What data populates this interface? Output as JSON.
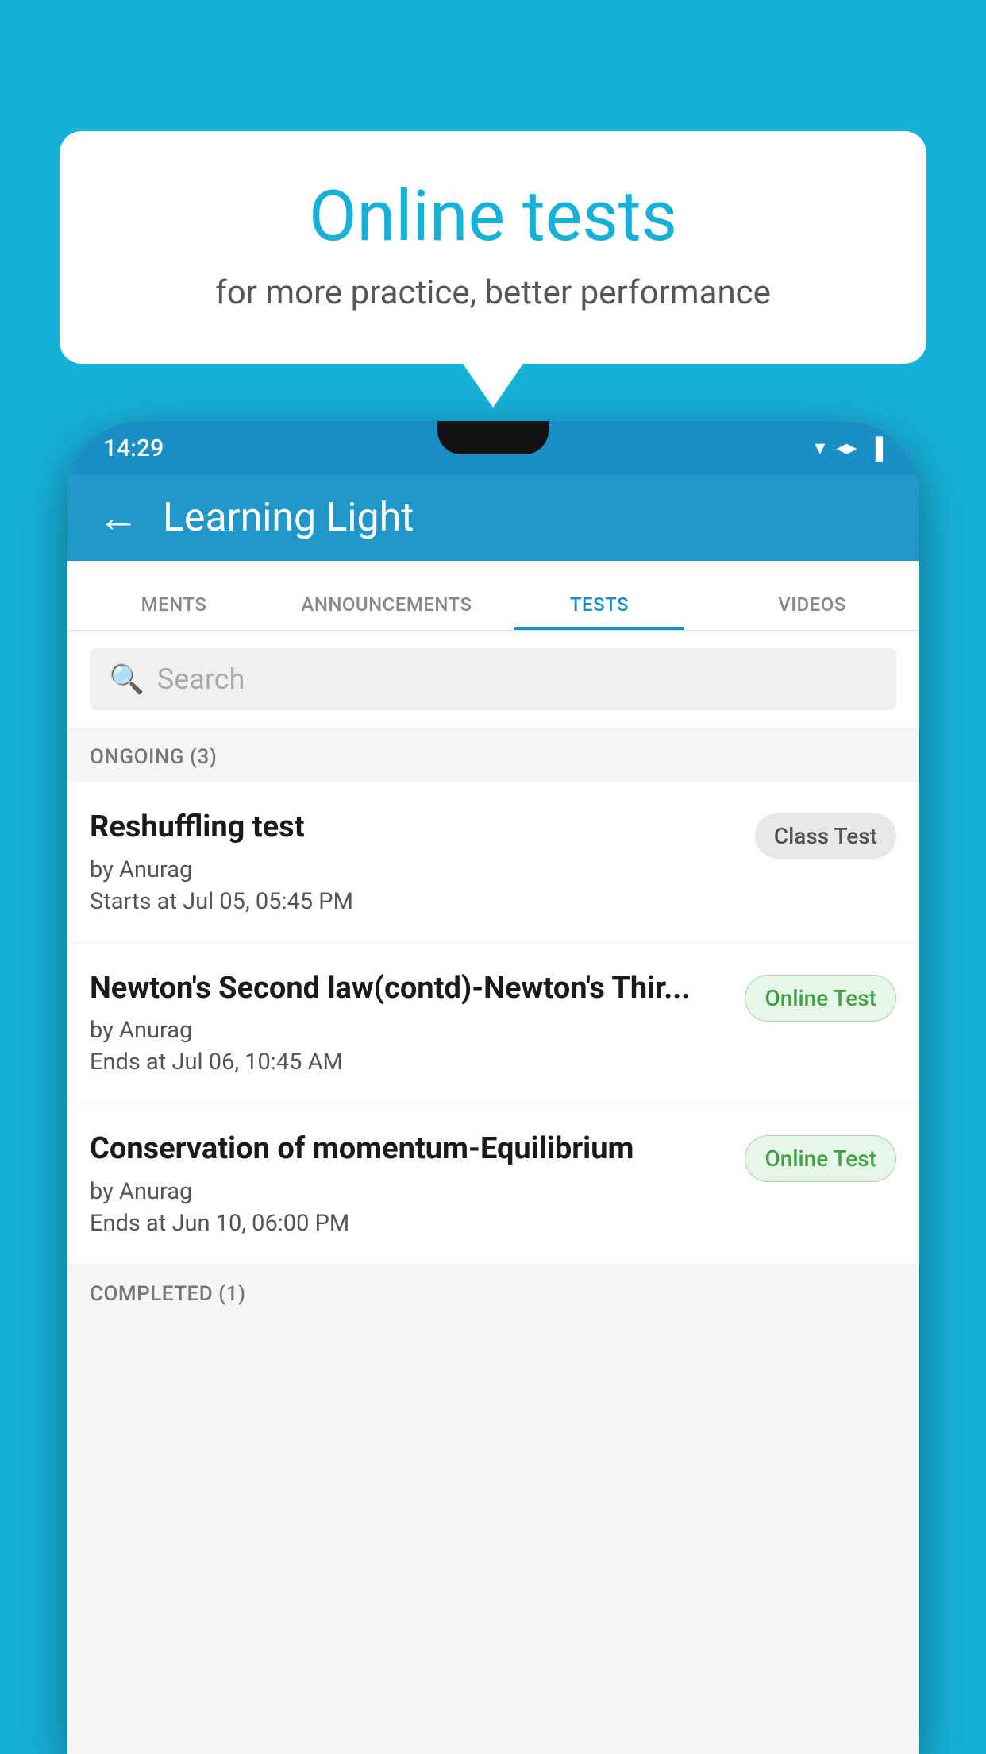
{
  "background_color": "#17b0d8",
  "bubble": {
    "title": "Online tests",
    "subtitle": "for more practice, better performance"
  },
  "phone": {
    "status_bar": {
      "time": "14:29",
      "icons": [
        "▼",
        "▲",
        "▌"
      ]
    },
    "app_bar": {
      "back_label": "←",
      "title": "Learning Light"
    },
    "tabs": [
      {
        "label": "MENTS",
        "active": false
      },
      {
        "label": "ANNOUNCEMENTS",
        "active": false
      },
      {
        "label": "TESTS",
        "active": true
      },
      {
        "label": "VIDEOS",
        "active": false
      }
    ],
    "search": {
      "placeholder": "Search"
    },
    "ongoing_section": {
      "label": "ONGOING (3)"
    },
    "tests": [
      {
        "name": "Reshuffling test",
        "by": "by Anurag",
        "date_label": "Starts at",
        "date": "Jul 05, 05:45 PM",
        "badge": "Class Test",
        "badge_type": "class"
      },
      {
        "name": "Newton's Second law(contd)-Newton's Thir...",
        "by": "by Anurag",
        "date_label": "Ends at",
        "date": "Jul 06, 10:45 AM",
        "badge": "Online Test",
        "badge_type": "online"
      },
      {
        "name": "Conservation of momentum-Equilibrium",
        "by": "by Anurag",
        "date_label": "Ends at",
        "date": "Jun 10, 06:00 PM",
        "badge": "Online Test",
        "badge_type": "online"
      }
    ],
    "completed_section": {
      "label": "COMPLETED (1)"
    }
  }
}
